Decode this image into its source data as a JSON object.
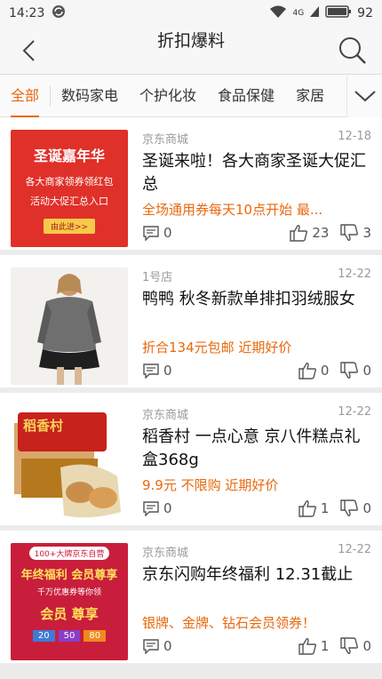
{
  "status": {
    "time": "14:23",
    "battery": "92",
    "network": "4G"
  },
  "header": {
    "title": "折扣爆料"
  },
  "tabs": [
    {
      "label": "全部"
    },
    {
      "label": "数码家电"
    },
    {
      "label": "个护化妆"
    },
    {
      "label": "食品保健"
    },
    {
      "label": "家居"
    }
  ],
  "items": [
    {
      "store": "京东商城",
      "date": "12-18",
      "title": "圣诞来啦！各大商家圣诞大促汇总",
      "price": "全场通用券每天10点开始 最...",
      "comments": "0",
      "likes": "23",
      "dislikes": "3",
      "thumb": {
        "line1": "圣诞嘉年华",
        "line2": "各大商家领券领红包",
        "line3": "活动大促汇总入口",
        "btn": "由此进>>"
      }
    },
    {
      "store": "1号店",
      "date": "12-22",
      "title": "鸭鸭 秋冬新款单排扣羽绒服女",
      "price": "折合134元包邮 近期好价",
      "comments": "0",
      "likes": "0",
      "dislikes": "0"
    },
    {
      "store": "京东商城",
      "date": "12-22",
      "title": "稻香村 一点心意 京八件糕点礼盒368g",
      "price": "9.9元 不限购 近期好价",
      "comments": "0",
      "likes": "1",
      "dislikes": "0",
      "thumb": {
        "brand": "稻香村"
      }
    },
    {
      "store": "京东商城",
      "date": "12-22",
      "title": "京东闪购年终福利 12.31截止",
      "price": "银牌、金牌、钻石会员领券！",
      "comments": "0",
      "likes": "1",
      "dislikes": "0",
      "thumb": {
        "top": "100+大牌京东自营",
        "line1": "年终福利 会员尊享",
        "line2": "千万优惠券等你领",
        "line3": "会员 尊享",
        "c1": "20",
        "c2": "50",
        "c3": "80"
      }
    }
  ]
}
